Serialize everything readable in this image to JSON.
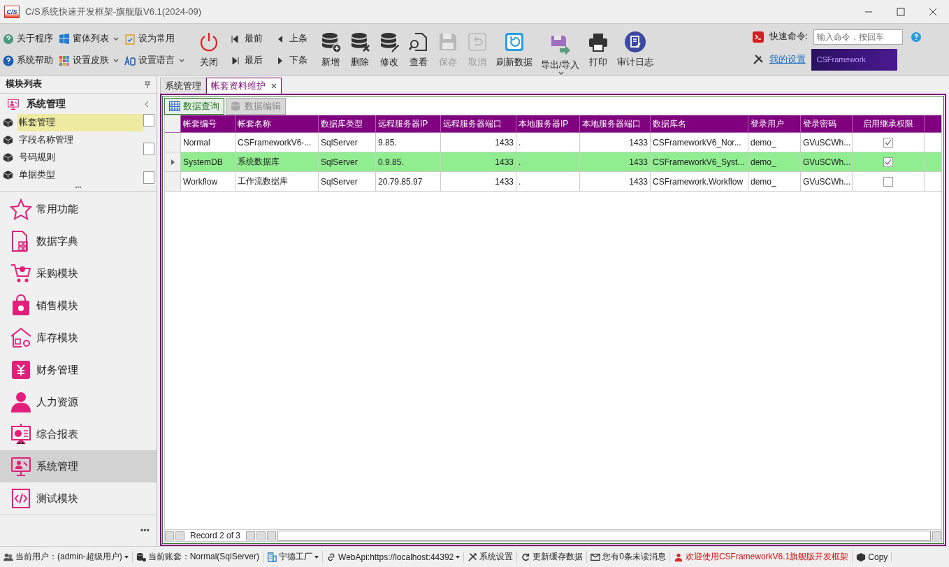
{
  "window": {
    "title": "C/S系统快速开发框架-旗舰版V6.1(2024-09)",
    "logo": "C/S"
  },
  "toolbar": {
    "small": [
      {
        "label": "关于程序",
        "dropdown": false
      },
      {
        "label": "窗体列表",
        "dropdown": true
      },
      {
        "label": "设为常用",
        "dropdown": false
      },
      {
        "label": "系统帮助",
        "dropdown": false
      },
      {
        "label": "设置皮肤",
        "dropdown": true
      },
      {
        "label": "设置语言",
        "dropdown": true
      }
    ],
    "close": "关闭",
    "nav": [
      "最前",
      "上条",
      "最后",
      "下条"
    ],
    "buttons": [
      {
        "label": "新增",
        "disabled": false,
        "dropdown": false
      },
      {
        "label": "删除",
        "disabled": false,
        "dropdown": false
      },
      {
        "label": "修改",
        "disabled": false,
        "dropdown": false
      },
      {
        "label": "查看",
        "disabled": false,
        "dropdown": false
      },
      {
        "label": "保存",
        "disabled": true,
        "dropdown": false
      },
      {
        "label": "取消",
        "disabled": true,
        "dropdown": false
      },
      {
        "label": "刷新数据",
        "disabled": false,
        "dropdown": false
      },
      {
        "label": "导出/导入",
        "disabled": false,
        "dropdown": true
      },
      {
        "label": "打印",
        "disabled": false,
        "dropdown": false
      },
      {
        "label": "审计日志",
        "disabled": false,
        "dropdown": false
      }
    ],
    "quick_command": {
      "label": "快速命令:",
      "placeholder": "输入命令，按回车"
    },
    "my_settings": "我的设置",
    "banner": "CSFramework"
  },
  "sidebar": {
    "title": "模块列表",
    "group": "系统管理",
    "sub_items": [
      {
        "label": "帐套管理",
        "selected": true
      },
      {
        "label": "字段名称管理",
        "selected": false
      },
      {
        "label": "号码规则",
        "selected": false
      },
      {
        "label": "单据类型",
        "selected": false
      }
    ],
    "modules": [
      {
        "label": "常用功能",
        "selected": false
      },
      {
        "label": "数据字典",
        "selected": false
      },
      {
        "label": "采购模块",
        "selected": false
      },
      {
        "label": "销售模块",
        "selected": false
      },
      {
        "label": "库存模块",
        "selected": false
      },
      {
        "label": "财务管理",
        "selected": false
      },
      {
        "label": "人力资源",
        "selected": false
      },
      {
        "label": "综合报表",
        "selected": false
      },
      {
        "label": "系统管理",
        "selected": true
      },
      {
        "label": "测试模块",
        "selected": false
      }
    ],
    "more": "•••"
  },
  "tabs": [
    {
      "label": "系统管理",
      "selected": false,
      "closable": false
    },
    {
      "label": "帐套资料维护",
      "selected": true,
      "closable": true
    }
  ],
  "sub_tabs": [
    {
      "label": "数据查询",
      "selected": true
    },
    {
      "label": "数据编辑",
      "selected": false
    }
  ],
  "table": {
    "columns": [
      "帐套编号",
      "帐套名称",
      "数据库类型",
      "远程服务器IP",
      "远程服务器端口",
      "本地服务器IP",
      "本地服务器端口",
      "数据库名",
      "登录用户",
      "登录密码",
      "启用继承权限"
    ],
    "rows": [
      {
        "selected": false,
        "cells": [
          "Normal",
          "CSFrameworkV6-...",
          "SqlServer",
          "9.85.",
          "1433",
          ".",
          "1433",
          "CSFrameworkV6_Nor...",
          "demo_",
          "GVuSCWh..."
        ],
        "checked": true
      },
      {
        "selected": true,
        "cells": [
          "SystemDB",
          "系统数据库",
          "SqlServer",
          "0.9.85.",
          "1433",
          ".",
          "1433",
          "CSFrameworkV6_Syst...",
          "demo_",
          "GVuSCWh..."
        ],
        "checked": true
      },
      {
        "selected": false,
        "cells": [
          "Workflow",
          "工作流数据库",
          "SqlServer",
          "20.79.85.97",
          "1433",
          ".",
          "1433",
          "CSFramework.Workflow",
          "demo_",
          "GVuSCWh..."
        ],
        "checked": false
      }
    ],
    "record": "Record 2 of 3"
  },
  "status_bar": [
    {
      "label": "当前用户：(admin-超级用户)",
      "dropdown": true,
      "alert": false
    },
    {
      "label": "当前账套：Normal(SqlServer)",
      "dropdown": false,
      "alert": false
    },
    {
      "label": "宁德工厂",
      "dropdown": true,
      "alert": false
    },
    {
      "label": "WebApi:https://localhost:44392",
      "dropdown": true,
      "alert": false
    },
    {
      "label": "系统设置",
      "dropdown": false,
      "alert": false
    },
    {
      "label": "更新缓存数据",
      "dropdown": false,
      "alert": false
    },
    {
      "label": "您有0条未读消息",
      "dropdown": false,
      "alert": false
    },
    {
      "label": "欢迎使用CSFrameworkV6.1旗舰版开发框架",
      "dropdown": false,
      "alert": true
    },
    {
      "label": "Copy",
      "dropdown": false,
      "alert": false
    }
  ]
}
